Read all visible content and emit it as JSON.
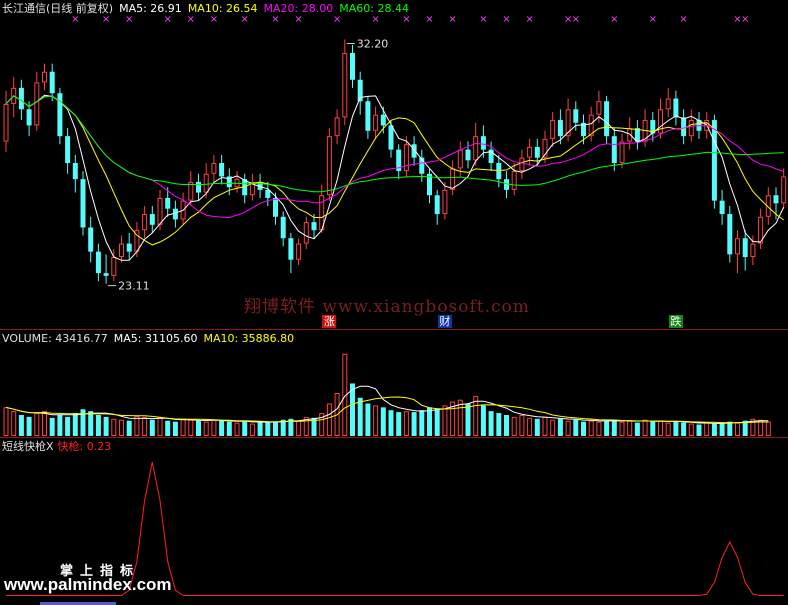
{
  "header_price": {
    "stock": "长江通信(日线 前复权)",
    "ma5": "MA5: 26.91",
    "ma10": "MA10: 26.54",
    "ma20": "MA20: 28.00",
    "ma60": "MA60: 28.44"
  },
  "header_volume": {
    "vol": "VOLUME: 43416.77",
    "ma5": "MA5: 31105.60",
    "ma10": "MA10: 35886.80"
  },
  "header_indicator": {
    "name": "短线快枪X",
    "value": "快枪: 0.23"
  },
  "watermark": "翔博软件 www.xiangbosoft.com",
  "logo": {
    "line1": "掌上指标",
    "line2": "www.palmindex.com"
  },
  "signal_tags": [
    {
      "label": "涨",
      "index": 42,
      "bg": "#cc1111",
      "fg": "#ffffff"
    },
    {
      "label": "财",
      "index": 57,
      "bg": "#1133aa",
      "fg": "#ffffff"
    },
    {
      "label": "跌",
      "index": 87,
      "bg": "#118811",
      "fg": "#ffffff"
    }
  ],
  "colors": {
    "up": "#ff4040",
    "down": "#54fcfc",
    "ma5": "#ffffff",
    "ma10": "#ffff00",
    "ma20": "#ff00ff",
    "ma60": "#00ff00",
    "indicator": "#ff2020",
    "marker": "#ff40ff"
  },
  "chart_data": [
    {
      "type": "candlestick",
      "title": "长江通信(日线 前复权)",
      "ylim": [
        22.5,
        33.0
      ],
      "annotations": [
        {
          "label": "32.20",
          "index": 44,
          "value": 32.2
        },
        {
          "label": "23.11",
          "index": 13,
          "value": 23.11
        }
      ],
      "markers_top": [
        9,
        13,
        16,
        21,
        24,
        27,
        31,
        35,
        38,
        43,
        48,
        52,
        55,
        58,
        62,
        65,
        68,
        73,
        74,
        79,
        84,
        88,
        95,
        96
      ],
      "candles": [
        {
          "o": 28.4,
          "c": 29.8,
          "h": 30.3,
          "l": 28.0
        },
        {
          "o": 29.8,
          "c": 30.4,
          "h": 30.8,
          "l": 29.3
        },
        {
          "o": 30.4,
          "c": 29.6,
          "h": 30.7,
          "l": 29.2
        },
        {
          "o": 29.6,
          "c": 29.0,
          "h": 29.9,
          "l": 28.6
        },
        {
          "o": 29.0,
          "c": 30.6,
          "h": 31.0,
          "l": 28.8
        },
        {
          "o": 30.6,
          "c": 31.0,
          "h": 31.3,
          "l": 30.3
        },
        {
          "o": 31.0,
          "c": 30.2,
          "h": 31.3,
          "l": 29.9
        },
        {
          "o": 30.2,
          "c": 28.6,
          "h": 30.4,
          "l": 28.3
        },
        {
          "o": 28.6,
          "c": 27.6,
          "h": 28.9,
          "l": 27.2
        },
        {
          "o": 27.6,
          "c": 27.0,
          "h": 27.9,
          "l": 26.5
        },
        {
          "o": 27.0,
          "c": 25.2,
          "h": 27.3,
          "l": 24.9
        },
        {
          "o": 25.2,
          "c": 24.3,
          "h": 25.6,
          "l": 23.9
        },
        {
          "o": 24.3,
          "c": 23.5,
          "h": 24.6,
          "l": 23.2
        },
        {
          "o": 23.5,
          "c": 23.4,
          "h": 24.2,
          "l": 23.11
        },
        {
          "o": 23.4,
          "c": 24.1,
          "h": 24.4,
          "l": 23.2
        },
        {
          "o": 24.1,
          "c": 24.6,
          "h": 24.9,
          "l": 23.9
        },
        {
          "o": 24.6,
          "c": 24.3,
          "h": 25.0,
          "l": 24.0
        },
        {
          "o": 24.3,
          "c": 25.1,
          "h": 25.4,
          "l": 24.1
        },
        {
          "o": 25.1,
          "c": 25.7,
          "h": 26.0,
          "l": 24.8
        },
        {
          "o": 25.7,
          "c": 25.3,
          "h": 26.0,
          "l": 25.0
        },
        {
          "o": 25.3,
          "c": 26.3,
          "h": 26.6,
          "l": 25.1
        },
        {
          "o": 26.3,
          "c": 25.9,
          "h": 26.7,
          "l": 25.6
        },
        {
          "o": 25.9,
          "c": 25.5,
          "h": 26.2,
          "l": 25.2
        },
        {
          "o": 25.5,
          "c": 26.2,
          "h": 26.5,
          "l": 25.3
        },
        {
          "o": 26.2,
          "c": 26.9,
          "h": 27.3,
          "l": 26.0
        },
        {
          "o": 26.9,
          "c": 26.5,
          "h": 27.2,
          "l": 26.2
        },
        {
          "o": 26.5,
          "c": 27.2,
          "h": 27.6,
          "l": 26.3
        },
        {
          "o": 27.2,
          "c": 27.6,
          "h": 27.9,
          "l": 26.9
        },
        {
          "o": 27.6,
          "c": 27.1,
          "h": 27.9,
          "l": 26.8
        },
        {
          "o": 27.1,
          "c": 26.7,
          "h": 27.4,
          "l": 26.4
        },
        {
          "o": 26.7,
          "c": 27.0,
          "h": 27.3,
          "l": 26.5
        },
        {
          "o": 27.0,
          "c": 26.4,
          "h": 27.2,
          "l": 26.1
        },
        {
          "o": 26.4,
          "c": 26.9,
          "h": 27.2,
          "l": 26.2
        },
        {
          "o": 26.9,
          "c": 26.6,
          "h": 27.2,
          "l": 26.3
        },
        {
          "o": 26.6,
          "c": 26.3,
          "h": 26.9,
          "l": 26.0
        },
        {
          "o": 26.3,
          "c": 25.6,
          "h": 26.5,
          "l": 25.3
        },
        {
          "o": 25.6,
          "c": 24.8,
          "h": 25.8,
          "l": 24.5
        },
        {
          "o": 24.8,
          "c": 24.0,
          "h": 25.0,
          "l": 23.5
        },
        {
          "o": 24.0,
          "c": 24.6,
          "h": 24.8,
          "l": 23.8
        },
        {
          "o": 24.6,
          "c": 25.4,
          "h": 25.6,
          "l": 24.4
        },
        {
          "o": 25.4,
          "c": 25.1,
          "h": 25.7,
          "l": 24.8
        },
        {
          "o": 25.1,
          "c": 26.4,
          "h": 26.8,
          "l": 25.0
        },
        {
          "o": 26.4,
          "c": 28.6,
          "h": 28.9,
          "l": 26.2
        },
        {
          "o": 28.6,
          "c": 29.3,
          "h": 29.6,
          "l": 28.3
        },
        {
          "o": 29.3,
          "c": 31.7,
          "h": 32.2,
          "l": 29.0
        },
        {
          "o": 31.7,
          "c": 30.7,
          "h": 32.0,
          "l": 30.4
        },
        {
          "o": 30.7,
          "c": 29.9,
          "h": 31.0,
          "l": 29.4
        },
        {
          "o": 29.9,
          "c": 28.8,
          "h": 30.1,
          "l": 28.5
        },
        {
          "o": 28.8,
          "c": 29.4,
          "h": 29.7,
          "l": 28.5
        },
        {
          "o": 29.4,
          "c": 29.0,
          "h": 29.7,
          "l": 28.7
        },
        {
          "o": 29.0,
          "c": 28.1,
          "h": 29.2,
          "l": 27.8
        },
        {
          "o": 28.1,
          "c": 27.3,
          "h": 28.3,
          "l": 27.0
        },
        {
          "o": 27.3,
          "c": 28.3,
          "h": 28.6,
          "l": 27.1
        },
        {
          "o": 28.3,
          "c": 27.8,
          "h": 28.6,
          "l": 27.5
        },
        {
          "o": 27.8,
          "c": 27.2,
          "h": 28.1,
          "l": 26.9
        },
        {
          "o": 27.2,
          "c": 26.4,
          "h": 27.4,
          "l": 26.1
        },
        {
          "o": 26.4,
          "c": 25.7,
          "h": 26.6,
          "l": 25.3
        },
        {
          "o": 25.7,
          "c": 26.6,
          "h": 26.9,
          "l": 25.5
        },
        {
          "o": 26.6,
          "c": 27.4,
          "h": 27.7,
          "l": 26.4
        },
        {
          "o": 27.4,
          "c": 28.1,
          "h": 28.4,
          "l": 27.1
        },
        {
          "o": 28.1,
          "c": 27.7,
          "h": 28.4,
          "l": 27.4
        },
        {
          "o": 27.7,
          "c": 28.6,
          "h": 29.1,
          "l": 27.5
        },
        {
          "o": 28.6,
          "c": 28.1,
          "h": 29.0,
          "l": 27.8
        },
        {
          "o": 28.1,
          "c": 27.6,
          "h": 28.4,
          "l": 27.3
        },
        {
          "o": 27.6,
          "c": 27.0,
          "h": 27.9,
          "l": 26.7
        },
        {
          "o": 27.0,
          "c": 26.6,
          "h": 27.3,
          "l": 26.3
        },
        {
          "o": 26.6,
          "c": 27.3,
          "h": 27.6,
          "l": 26.4
        },
        {
          "o": 27.3,
          "c": 27.8,
          "h": 28.1,
          "l": 27.0
        },
        {
          "o": 27.8,
          "c": 28.2,
          "h": 28.5,
          "l": 27.5
        },
        {
          "o": 28.2,
          "c": 27.8,
          "h": 28.5,
          "l": 27.5
        },
        {
          "o": 27.8,
          "c": 28.5,
          "h": 28.8,
          "l": 27.6
        },
        {
          "o": 28.5,
          "c": 29.2,
          "h": 29.5,
          "l": 28.2
        },
        {
          "o": 29.2,
          "c": 28.6,
          "h": 29.6,
          "l": 28.3
        },
        {
          "o": 28.6,
          "c": 29.6,
          "h": 30.0,
          "l": 28.4
        },
        {
          "o": 29.6,
          "c": 29.1,
          "h": 29.9,
          "l": 28.8
        },
        {
          "o": 29.1,
          "c": 28.6,
          "h": 29.4,
          "l": 28.3
        },
        {
          "o": 28.6,
          "c": 29.4,
          "h": 29.7,
          "l": 28.4
        },
        {
          "o": 29.4,
          "c": 29.9,
          "h": 30.3,
          "l": 29.1
        },
        {
          "o": 29.9,
          "c": 28.6,
          "h": 30.1,
          "l": 28.3
        },
        {
          "o": 28.6,
          "c": 27.6,
          "h": 28.9,
          "l": 27.3
        },
        {
          "o": 27.6,
          "c": 28.4,
          "h": 28.7,
          "l": 27.4
        },
        {
          "o": 28.4,
          "c": 28.9,
          "h": 29.3,
          "l": 28.1
        },
        {
          "o": 28.9,
          "c": 28.4,
          "h": 29.2,
          "l": 28.1
        },
        {
          "o": 28.4,
          "c": 29.2,
          "h": 29.6,
          "l": 28.2
        },
        {
          "o": 29.2,
          "c": 28.7,
          "h": 29.5,
          "l": 28.4
        },
        {
          "o": 28.7,
          "c": 29.6,
          "h": 30.0,
          "l": 28.5
        },
        {
          "o": 29.6,
          "c": 30.0,
          "h": 30.4,
          "l": 29.3
        },
        {
          "o": 30.0,
          "c": 29.3,
          "h": 30.3,
          "l": 29.0
        },
        {
          "o": 29.3,
          "c": 28.6,
          "h": 29.6,
          "l": 28.3
        },
        {
          "o": 28.6,
          "c": 29.2,
          "h": 29.6,
          "l": 28.4
        },
        {
          "o": 29.2,
          "c": 28.8,
          "h": 29.5,
          "l": 28.5
        },
        {
          "o": 28.8,
          "c": 29.2,
          "h": 29.5,
          "l": 28.5
        },
        {
          "o": 29.2,
          "c": 26.2,
          "h": 29.4,
          "l": 25.9
        },
        {
          "o": 26.2,
          "c": 25.7,
          "h": 26.6,
          "l": 25.3
        },
        {
          "o": 25.7,
          "c": 24.2,
          "h": 26.0,
          "l": 23.9
        },
        {
          "o": 24.2,
          "c": 24.8,
          "h": 25.1,
          "l": 23.5
        },
        {
          "o": 24.8,
          "c": 24.1,
          "h": 25.1,
          "l": 23.6
        },
        {
          "o": 24.1,
          "c": 24.6,
          "h": 24.9,
          "l": 23.8
        },
        {
          "o": 24.6,
          "c": 25.6,
          "h": 25.9,
          "l": 24.4
        },
        {
          "o": 25.6,
          "c": 26.4,
          "h": 26.7,
          "l": 25.3
        },
        {
          "o": 26.4,
          "c": 26.1,
          "h": 26.7,
          "l": 25.5
        },
        {
          "o": 26.1,
          "c": 27.1,
          "h": 27.4,
          "l": 25.9
        }
      ]
    },
    {
      "type": "bar",
      "title": "VOLUME",
      "ylim": [
        0,
        90000
      ],
      "values": [
        30000,
        26000,
        22000,
        20000,
        24000,
        26000,
        19000,
        22000,
        20000,
        24000,
        28000,
        26000,
        22000,
        20000,
        18000,
        17000,
        16000,
        21000,
        20000,
        17000,
        19000,
        16000,
        15000,
        18000,
        17000,
        16000,
        15000,
        17000,
        16000,
        15000,
        14000,
        16000,
        13000,
        15000,
        14000,
        15000,
        17000,
        18000,
        16000,
        20000,
        19000,
        24000,
        34000,
        45000,
        86000,
        55000,
        40000,
        34000,
        32000,
        30000,
        27000,
        25000,
        26000,
        25000,
        27000,
        30000,
        29000,
        32000,
        36000,
        38000,
        34000,
        42000,
        32000,
        26000,
        24000,
        22000,
        20000,
        22000,
        19000,
        18000,
        20000,
        17000,
        18000,
        16000,
        17000,
        15000,
        16000,
        15000,
        16000,
        17000,
        15000,
        16000,
        14000,
        17000,
        15000,
        16000,
        14000,
        15000,
        14000,
        13000,
        12000,
        14000,
        13000,
        14000,
        15000,
        14000,
        16000,
        18000,
        17000,
        15000
      ]
    },
    {
      "type": "line",
      "title": "短线快枪X",
      "ylim": [
        0,
        1.0
      ],
      "name": "快枪",
      "spikes": [
        {
          "index": 19,
          "value": 0.93
        },
        {
          "index": 94,
          "value": 0.38
        }
      ]
    }
  ]
}
